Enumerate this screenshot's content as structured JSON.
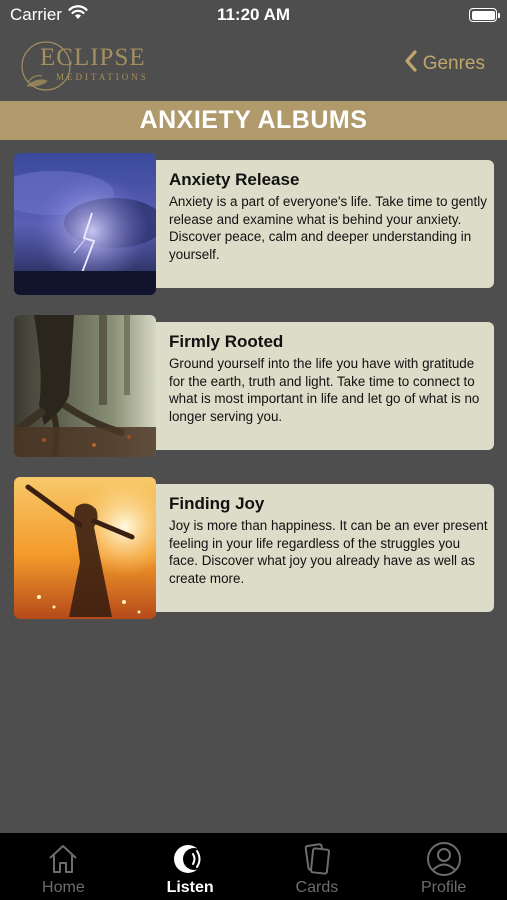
{
  "status_bar": {
    "carrier": "Carrier",
    "time": "11:20 AM"
  },
  "header": {
    "logo_title": "ECLIPSE",
    "logo_subtitle": "MEDITATIONS",
    "back_label": "Genres"
  },
  "page": {
    "title": "ANXIETY ALBUMS"
  },
  "albums": [
    {
      "title": "Anxiety Release",
      "description": "Anxiety is a part of everyone's life. Take time to gently release and examine what is behind your anxiety. Discover peace, calm and deeper understanding in yourself."
    },
    {
      "title": "Firmly Rooted",
      "description": "Ground yourself into the life you have with gratitude for the earth, truth and light. Take time to connect to what is most important in life and let go of what is no longer serving you."
    },
    {
      "title": "Finding Joy",
      "description": "Joy is more than happiness. It can be an ever present feeling in your life regardless of the struggles you face. Discover what joy you already have as well as create more."
    }
  ],
  "tabs": [
    {
      "label": "Home",
      "icon": "home-icon",
      "active": false
    },
    {
      "label": "Listen",
      "icon": "listen-icon",
      "active": true
    },
    {
      "label": "Cards",
      "icon": "cards-icon",
      "active": false
    },
    {
      "label": "Profile",
      "icon": "profile-icon",
      "active": false
    }
  ],
  "colors": {
    "background": "#4e4e4e",
    "accent_gold": "#b09a6c",
    "card_panel": "#dcdcc9",
    "tabbar": "#000000"
  }
}
